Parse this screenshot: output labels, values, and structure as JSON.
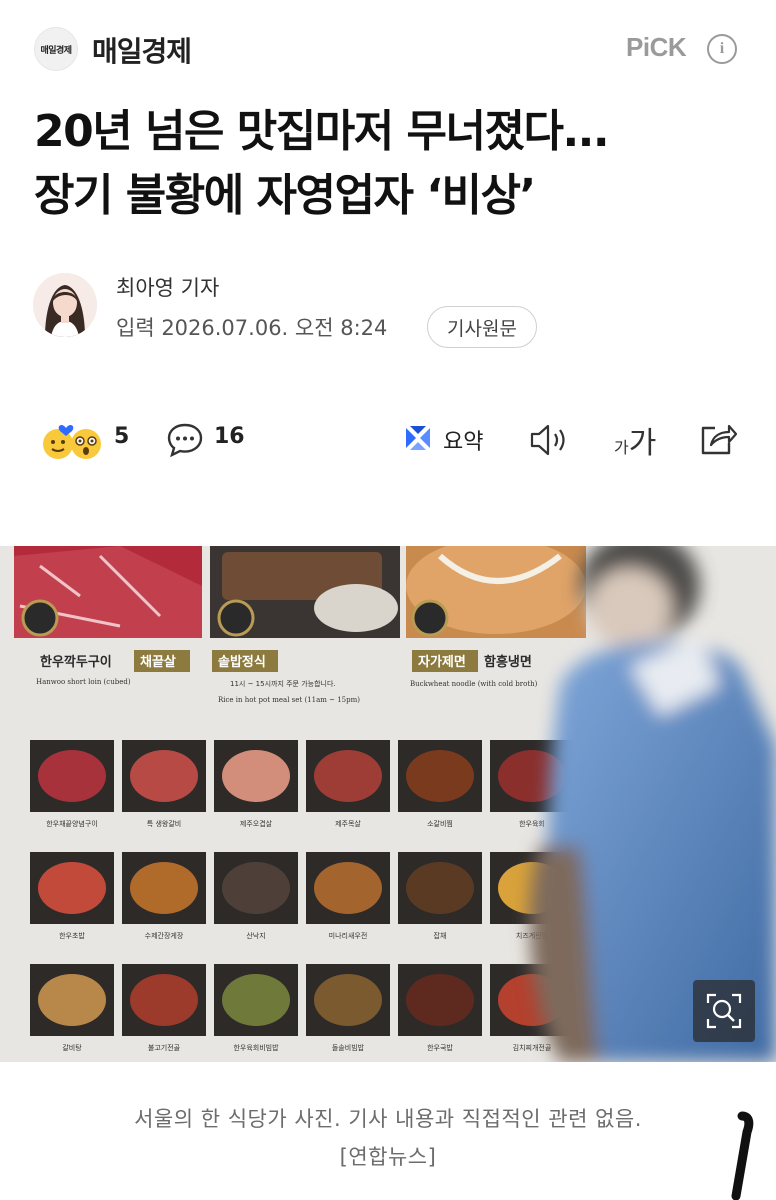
{
  "press": {
    "logo_text": "매일경제",
    "name": "매일경제",
    "pick_label": "PiCK",
    "info_label": "i"
  },
  "article": {
    "title_line1": "20년 넘은 맛집마저 무너졌다...",
    "title_line2": "장기 불황에 자영업자 ‘비상’",
    "reporter": "최아영 기자",
    "published": "입력 2026.07.06. 오전 8:24",
    "origin_button": "기사원문"
  },
  "toolbar": {
    "reaction_count": "5",
    "comment_count": "16",
    "summary_label": "요약",
    "font_small": "가",
    "font_big": "가"
  },
  "photo": {
    "menu_labels": [
      "한우깍두구이",
      "채끝살",
      "솥밥정식",
      "자가제면",
      "함흥냉면"
    ],
    "menu_sublabels": [
      "Hanwoo short loin (cubed)",
      "Rice in hot pot meal set (11am ~ 15pm)",
      "Buckwheat noodle (with cold broth)"
    ],
    "menu_note": "11시 ~ 15시까지 주문 가능합니다.",
    "dish_labels": [
      "한우채끝양념구이",
      "특 생왕갈비",
      "제주오겹살",
      "제주목살",
      "소갈비찜",
      "한우육회",
      "한우초밥",
      "수제간장게장",
      "산낙지",
      "미나리새우전",
      "잡채",
      "치즈계란찜",
      "갈비탕",
      "불고기전골",
      "한우육회비빔밥",
      "돌솥비빔밥",
      "한우국밥",
      "김치찌개전골"
    ]
  },
  "caption": {
    "text": "서울의 한 식당가 사진. 기사 내용과 직접적인 관련 없음.",
    "source": "[연합뉴스]"
  },
  "colors": {
    "accent_blue": "#2f6bff",
    "text_primary": "#111111",
    "text_muted": "#6c6c6c"
  }
}
